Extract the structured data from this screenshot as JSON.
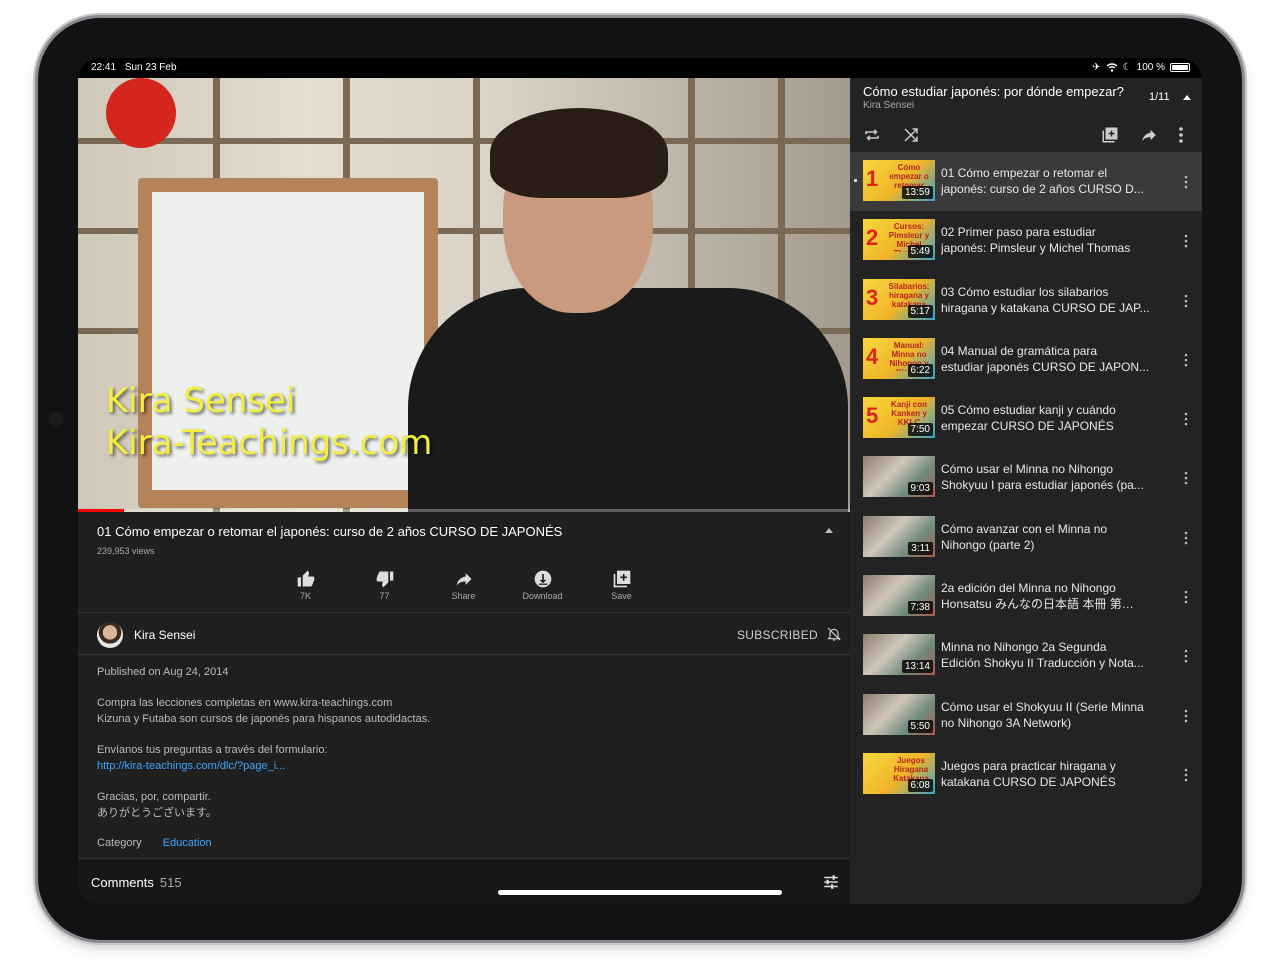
{
  "status_bar": {
    "time": "22:41",
    "date": "Sun 23 Feb",
    "battery": "100 %"
  },
  "video": {
    "watermark_line1": "Kira Sensei",
    "watermark_line2": "Kira-Teachings.com",
    "progress": 0.06
  },
  "info": {
    "title": "01 Cómo empezar o retomar el japonés: curso de 2 años CURSO DE JAPONÉS",
    "views": "239,953 views",
    "actions": [
      {
        "label": "7K",
        "icon": "thumbs-up-icon"
      },
      {
        "label": "77",
        "icon": "thumbs-down-icon"
      },
      {
        "label": "Share",
        "icon": "share-icon"
      },
      {
        "label": "Download",
        "icon": "download-icon"
      },
      {
        "label": "Save",
        "icon": "add-to-playlist-icon"
      }
    ],
    "channel": "Kira Sensei",
    "subscribed": "SUBSCRIBED",
    "published": "Published on Aug 24, 2014",
    "desc_line1": "Compra las lecciones completas en www.kira-teachings.com",
    "desc_line2": "Kizuna y Futaba son cursos de japonés para hispanos autodidactas.",
    "desc_line3": "Envíanos tus preguntas a través del formulario:",
    "desc_link": "http://kira-teachings.com/dlc/?page_i...",
    "desc_line4": "Gracias, por, compartir.",
    "desc_line5": "ありがとうございます。",
    "category_label": "Category",
    "category_value": "Education",
    "comments_label": "Comments",
    "comments_count": "515"
  },
  "playlist": {
    "title": "Cómo estudiar japonés: por dónde empezar?",
    "channel": "Kira Sensei",
    "position": "1/11",
    "items": [
      {
        "line1": "01 Cómo empezar o retomar el",
        "line2": "japonés: curso de 2 años CURSO D...",
        "duration": "13:59",
        "thumb_num": "1",
        "thumb_text": "Cómo empezar o retomar",
        "style": "yellow"
      },
      {
        "line1": "02 Primer paso para estudiar",
        "line2": "japonés: Pimsleur y Michel Thomas",
        "duration": "5:49",
        "thumb_num": "2",
        "thumb_text": "Cursos: Pimsleur y Michel Thomas",
        "style": "yellow"
      },
      {
        "line1": "03 Cómo estudiar los silabarios",
        "line2": "hiragana y katakana CURSO DE JAP...",
        "duration": "5:17",
        "thumb_num": "3",
        "thumb_text": "Silabarios: hiragana y katakana",
        "style": "yellow"
      },
      {
        "line1": "04 Manual de gramática para",
        "line2": "estudiar japonés CURSO DE JAPON...",
        "duration": "6:22",
        "thumb_num": "4",
        "thumb_text": "Manual: Minna no Nihongo y Kizuna",
        "style": "yellow"
      },
      {
        "line1": "05 Cómo estudiar kanji y cuándo",
        "line2": "empezar CURSO DE JAPONÉS",
        "duration": "7:50",
        "thumb_num": "5",
        "thumb_text": "Kanji con Kanken y KKLC",
        "style": "yellow"
      },
      {
        "line1": "Cómo usar el Minna no Nihongo",
        "line2": "Shokyuu I para estudiar japonés (pa...",
        "duration": "9:03",
        "thumb_num": "",
        "thumb_text": "",
        "style": "photo"
      },
      {
        "line1": "Cómo avanzar con el Minna no",
        "line2": "Nihongo (parte 2)",
        "duration": "3:11",
        "thumb_num": "",
        "thumb_text": "",
        "style": "photo"
      },
      {
        "line1": "2a edición del Minna no Nihongo",
        "line2": "Honsatsu みんなの日本語 本冊 第…",
        "duration": "7:38",
        "thumb_num": "",
        "thumb_text": "",
        "style": "photo"
      },
      {
        "line1": "Minna no Nihongo 2a Segunda",
        "line2": "Edición Shokyu II Traducción y Nota...",
        "duration": "13:14",
        "thumb_num": "",
        "thumb_text": "",
        "style": "photo"
      },
      {
        "line1": "Cómo usar el Shokyuu II (Serie Minna",
        "line2": "no Nihongo 3A Network)",
        "duration": "5:50",
        "thumb_num": "",
        "thumb_text": "",
        "style": "photo"
      },
      {
        "line1": "Juegos para practicar hiragana y",
        "line2": "katakana CURSO DE JAPONÉS",
        "duration": "6:08",
        "thumb_num": "",
        "thumb_text": "Juegos Hiragana Katakana",
        "style": "yellow"
      }
    ]
  }
}
